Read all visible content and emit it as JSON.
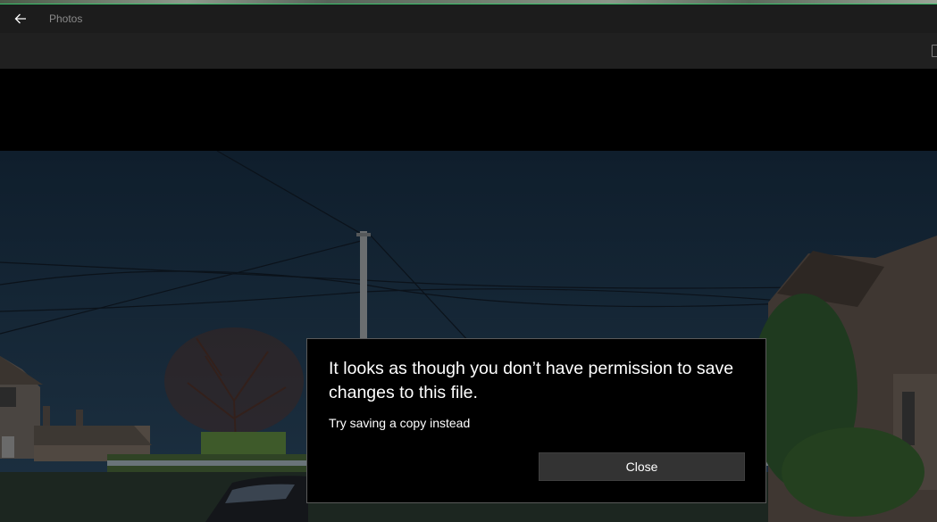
{
  "app": {
    "title": "Photos"
  },
  "titlebar": {
    "back_icon": "arrow-left-icon"
  },
  "toolbar": {
    "right_icon": "save-icon"
  },
  "dialog": {
    "title": "It looks as though you don’t have permission to save changes to this file.",
    "message": "Try saving a copy instead",
    "close_label": "Close"
  },
  "colors": {
    "titlebar_bg": "#1c1c1c",
    "toolbar_bg": "#202020",
    "dialog_bg": "#000000",
    "dialog_border": "#5a5a5a",
    "button_bg": "#333333",
    "accent_line": "#39c06a"
  }
}
